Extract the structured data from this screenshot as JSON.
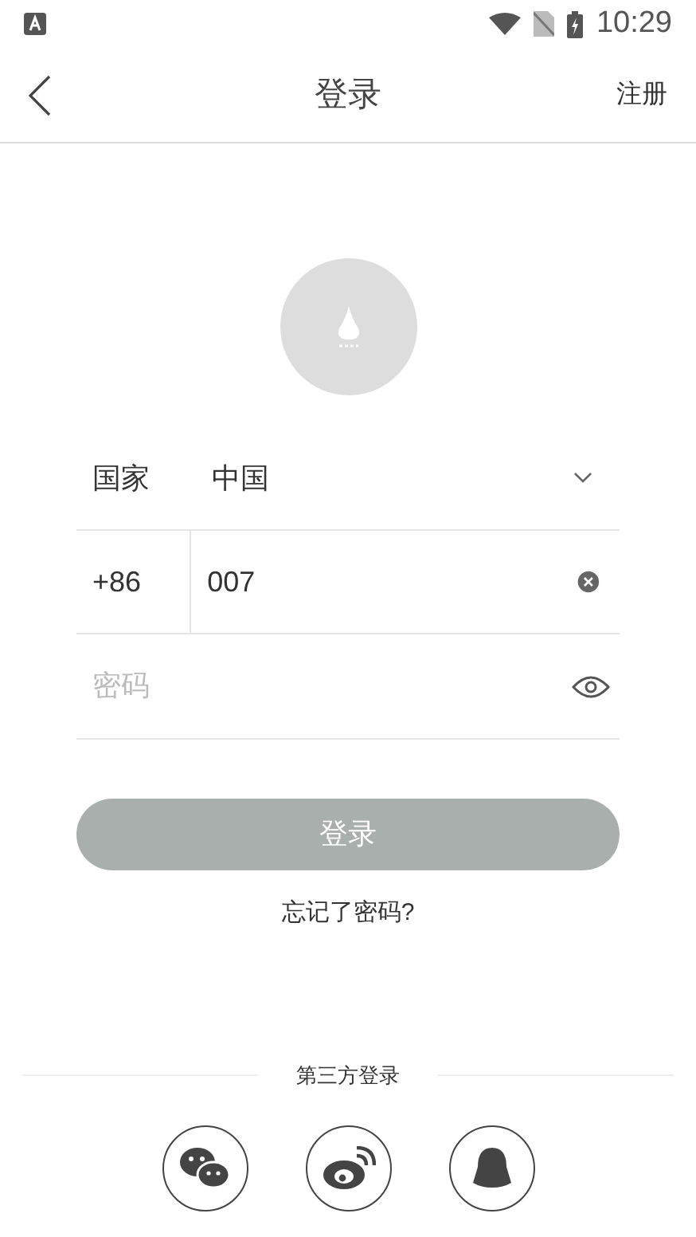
{
  "status_bar": {
    "time": "10:29"
  },
  "header": {
    "title": "登录",
    "action": "注册"
  },
  "country": {
    "label": "国家",
    "value": "中国"
  },
  "phone": {
    "code": "+86",
    "value": "007"
  },
  "password": {
    "placeholder": "密码"
  },
  "login_button": "登录",
  "forgot_link": "忘记了密码?",
  "third_party": {
    "label": "第三方登录"
  }
}
